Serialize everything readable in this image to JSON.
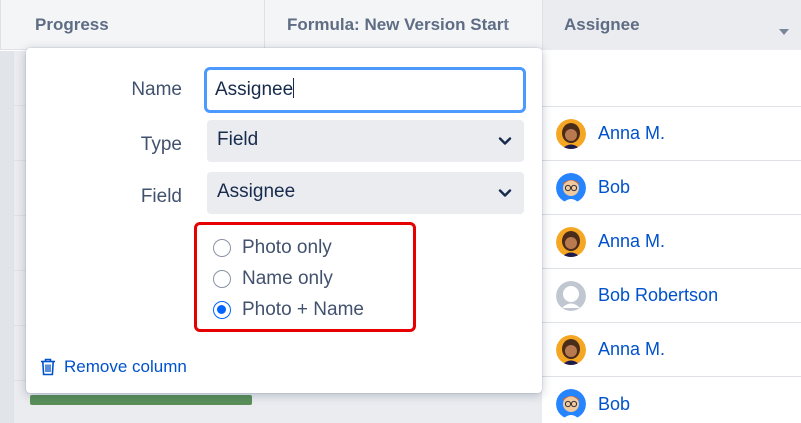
{
  "table": {
    "columns": {
      "progress": "Progress",
      "formula": "Formula: New Version Start",
      "assignee": "Assignee"
    },
    "assignee_rows": [
      {
        "name": "Anna M.",
        "avatar": "avatar-anna"
      },
      {
        "name": "Bob",
        "avatar": "avatar-bob"
      },
      {
        "name": "Anna M.",
        "avatar": "avatar-anna"
      },
      {
        "name": "Bob Robertson",
        "avatar": "avatar-default"
      },
      {
        "name": "Anna M.",
        "avatar": "avatar-anna"
      },
      {
        "name": "Bob",
        "avatar": "avatar-bob"
      }
    ]
  },
  "popup": {
    "name_label": "Name",
    "name_value": "Assignee",
    "type_label": "Type",
    "type_value": "Field",
    "field_label": "Field",
    "field_value": "Assignee",
    "display_options": [
      {
        "label": "Photo only",
        "selected": false
      },
      {
        "label": "Name only",
        "selected": false
      },
      {
        "label": "Photo + Name",
        "selected": true
      }
    ],
    "remove_label": "Remove column"
  },
  "colors": {
    "link": "#0052cc",
    "focus_border": "#4c9aff",
    "highlight_border": "#e60000",
    "radio_selected": "#0065ff",
    "progress_bar": "#5a8f5a"
  }
}
